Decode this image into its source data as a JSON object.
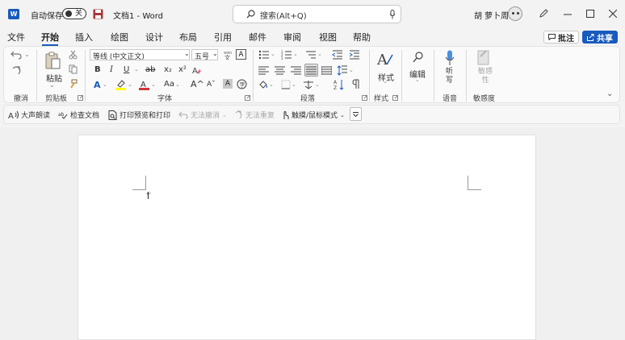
{
  "titlebar": {
    "autosave_label": "自动保存",
    "autosave_state": "关",
    "doc_title": "文档1  -  Word",
    "search_placeholder": "搜索(Alt+Q)",
    "user_name": "胡 萝卜周"
  },
  "tabs": [
    {
      "label": "文件"
    },
    {
      "label": "开始"
    },
    {
      "label": "插入"
    },
    {
      "label": "绘图"
    },
    {
      "label": "设计"
    },
    {
      "label": "布局"
    },
    {
      "label": "引用"
    },
    {
      "label": "邮件"
    },
    {
      "label": "审阅"
    },
    {
      "label": "视图"
    },
    {
      "label": "帮助"
    }
  ],
  "active_tab": "开始",
  "actions": {
    "comments_label": "批注",
    "share_label": "共享"
  },
  "ribbon": {
    "undo_group_label": "撤消",
    "clipboard": {
      "paste_label": "粘贴",
      "group_label": "剪贴板"
    },
    "font": {
      "font_name": "等线 (中文正文)",
      "font_size": "五号",
      "bold": "B",
      "italic": "I",
      "underline": "U",
      "strike": "ab",
      "subscript": "x₂",
      "superscript": "x²",
      "change_case": "Aa",
      "grow": "A^",
      "shrink": "Aˇ",
      "char_shade": "A",
      "group_label": "字体"
    },
    "paragraph": {
      "group_label": "段落"
    },
    "styles": {
      "label": "样式",
      "group_label": "样式"
    },
    "editing": {
      "label": "编辑"
    },
    "voice": {
      "dictate_label": "听写",
      "group_label": "语音"
    },
    "sensitivity": {
      "label": "敏感性",
      "group_label": "敏感度"
    }
  },
  "quick_access": {
    "read_aloud": "大声朗读",
    "check_doc": "检查文档",
    "print_preview": "打印预览和打印",
    "undo_disabled": "无法撤消",
    "redo_disabled": "无法重复",
    "touch_mode": "触摸/鼠标模式"
  },
  "colors": {
    "accent": "#185abd",
    "word_blue": "#185abd",
    "highlight": "#ffff00",
    "font_color": "#d13438",
    "save_icon": "#a4373a"
  }
}
